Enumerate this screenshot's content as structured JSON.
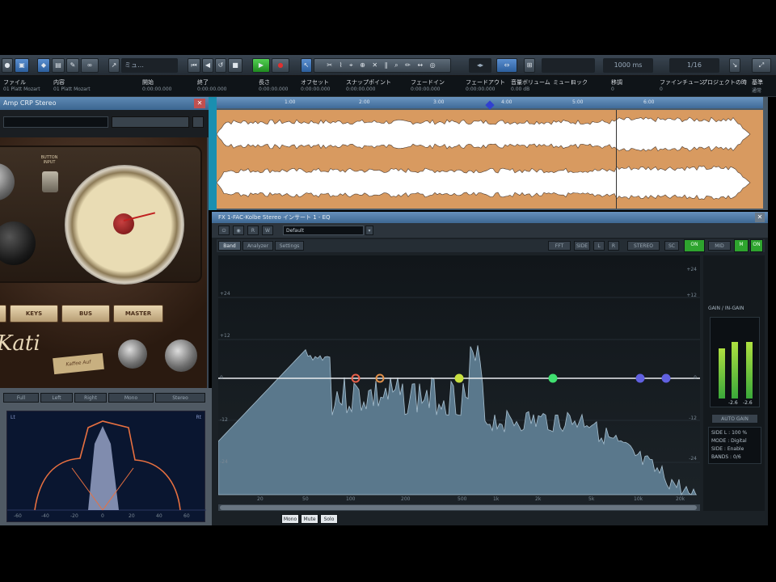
{
  "toolbar": {
    "track_field": "ミュ…",
    "time_left": "",
    "zoom_field": "1000 ms",
    "range_field": "1/16"
  },
  "infoline": {
    "headers": [
      "ファイル",
      "内容",
      "開始",
      "終了",
      "長さ",
      "オフセット",
      "スナップポイント",
      "フェードイン",
      "フェードアウト",
      "音量ボリューム",
      "ミュート",
      "ロック",
      "移調",
      "ファインチューン",
      "プロジェクトの時",
      "基準"
    ],
    "row1": [
      "01 Platt Mozart",
      "01 Platt Mozart",
      "0:00:00.000",
      "0:00:00.000",
      "0:00:00.000",
      "0:00:00.000",
      "0:00:00.000",
      "0:00:00.000",
      "0:00:00.000",
      "0.00 dB",
      "",
      "",
      "0",
      "0",
      "",
      "通常"
    ]
  },
  "plugin": {
    "title": "Amp CRP Stereo",
    "preset": "",
    "meter_label": "BUTTON INPUT",
    "buttons": [
      "KEYS",
      "BUS",
      "MASTER"
    ],
    "brand": "Kati",
    "badge": "Kaffee Auf"
  },
  "scope": {
    "tab_labels": [
      "Full",
      "Left",
      "Right",
      "Mono",
      "Stereo"
    ],
    "corner_left": "Lt",
    "corner_right": "Rt",
    "x_ticks": [
      "-60",
      "-40",
      "-20",
      "0",
      "20",
      "40",
      "60"
    ]
  },
  "waveform": {
    "ruler_marks": [
      "1:00",
      "2:00",
      "3:00",
      "4:00",
      "5:00",
      "6:00"
    ]
  },
  "eq": {
    "title": "FX 1-FAC-Kolbe Stereo インサート 1 - EQ",
    "preset": "Default",
    "tabs": [
      "Band",
      "Analyzer",
      "Settings"
    ],
    "header_right": [
      "FFT",
      "SIDE",
      "L",
      "R",
      "STEREO",
      "SC",
      "ON",
      "MID",
      "M",
      "ON"
    ],
    "db_left": [
      "+24",
      "+12",
      "0",
      "-12",
      "-24"
    ],
    "db_right": [
      "+24",
      "+12",
      "0",
      "-12",
      "-24"
    ],
    "freq_ticks": [
      "20",
      "50",
      "100",
      "200",
      "500",
      "1k",
      "2k",
      "5k",
      "10k",
      "20k"
    ],
    "meter_title": "GAIN / IN-GAIN",
    "meter_values": [
      "-2.6",
      "-2.6"
    ],
    "auto_gain": "AUTO GAIN",
    "stats": [
      "SIDE L : 100 %",
      "MODE : Digital",
      "SIDE : Enable",
      "BANDS : 0/6"
    ],
    "status_items": [
      "Mono",
      "Mute",
      "Solo"
    ],
    "nodes_colors": [
      "#e8604a",
      "#e0904a",
      "#c8e040",
      "#40e070",
      "#6060e0",
      "#6060e0"
    ]
  },
  "colors": {
    "wave_bg": "#d89a60",
    "spectrum": "#5a788c",
    "accent_green": "#2ea42e"
  }
}
